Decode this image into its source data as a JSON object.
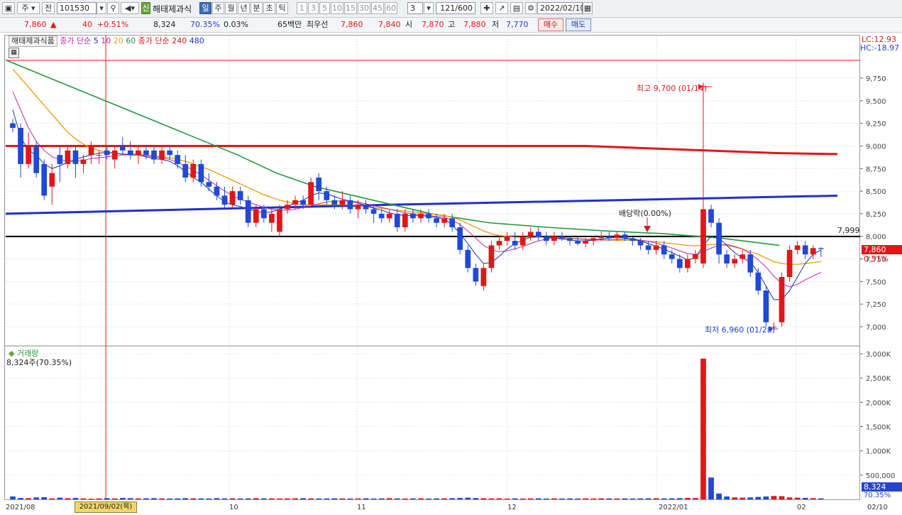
{
  "toolbar": {
    "period_type": "주",
    "market_label": "전",
    "stock_code": "101530",
    "stock_name": "해태제과식",
    "badge_label": "신",
    "period_tabs": [
      "일",
      "주",
      "월",
      "년",
      "분",
      "초",
      "틱"
    ],
    "interval_buttons": [
      "1",
      "3",
      "5",
      "10",
      "15",
      "30",
      "45",
      "60"
    ],
    "interval_value": "3",
    "count_display": "121",
    "count_total": "/600",
    "date_value": "2022/02/10"
  },
  "quote": {
    "price": "7,860",
    "arrow": "▲",
    "change": "40",
    "change_pct": "+0.51%",
    "volume": "8,324",
    "volume_ratio": "70.35%",
    "turnover": "0.03%",
    "amount": "65백만",
    "priority_label": "최우선",
    "ask": "7,860",
    "bid": "7,840",
    "open_label": "시",
    "open": "7,870",
    "high_label": "고",
    "high": "7,880",
    "low_label": "저",
    "low": "7,770",
    "buy_label": "매수",
    "sell_label": "매도"
  },
  "legend": {
    "name": "해태제과식품",
    "ma_label1": "종가 단순",
    "ma_short": [
      "5",
      "10",
      "20",
      "60"
    ],
    "ma_label2": "종가 단순",
    "ma_long": [
      "240",
      "480"
    ]
  },
  "annotations": {
    "high_note": "최고 9,700 (01/14)",
    "low_note": "최저 6,960 (01/28)",
    "dividend_note": "배당락(0.00%)",
    "hline_value": "7,999",
    "lc": "LC:12.93",
    "hc": "HC:-18.97",
    "price_tag": "7,860",
    "pct_tag": "0.51%",
    "vol_tag": "8,324",
    "vol_pct_tag": "70.35%"
  },
  "volume_panel": {
    "title": "거래량",
    "info": "8,324주(70.35%)"
  },
  "colors": {
    "up": "#e0161b",
    "down": "#1f49d6",
    "ma5": "#1c2fa8",
    "ma10": "#c026b3",
    "ma20": "#e6a117",
    "ma60": "#1f9a3a",
    "ma240": "#e0161b",
    "ma480": "#1f2fd0"
  },
  "chart_data": {
    "type": "candlestick",
    "y_ticks": [
      "9,750",
      "9,500",
      "9,250",
      "9,000",
      "8,750",
      "8,500",
      "8,250",
      "8,000",
      "7,750",
      "7,500",
      "7,250",
      "7,000"
    ],
    "ylim": [
      6800,
      10000
    ],
    "volume_ticks": [
      "3,000K",
      "2,500K",
      "2,000K",
      "1,500K",
      "1,000K",
      "500,000"
    ],
    "x_labels": [
      "2021/08",
      "9",
      "10",
      "11",
      "12",
      "2022/01",
      "02",
      "02/10"
    ],
    "selected_date": "2021/09/02(목)",
    "candles": [
      [
        9250,
        9300,
        9150,
        9200
      ],
      [
        9200,
        9250,
        8650,
        8800
      ],
      [
        8800,
        9150,
        8750,
        9000
      ],
      [
        9000,
        9050,
        8650,
        8700
      ],
      [
        8800,
        8850,
        8400,
        8450
      ],
      [
        8550,
        8800,
        8350,
        8700
      ],
      [
        8900,
        9000,
        8600,
        8800
      ],
      [
        8800,
        9000,
        8750,
        8950
      ],
      [
        8950,
        9000,
        8650,
        8800
      ],
      [
        8800,
        8900,
        8700,
        8850
      ],
      [
        8900,
        9050,
        8800,
        9000
      ],
      [
        8900,
        8950,
        8800,
        8900
      ],
      [
        8950,
        9000,
        8850,
        8900
      ],
      [
        8850,
        9000,
        8750,
        8950
      ],
      [
        9000,
        9100,
        8900,
        8950
      ],
      [
        8950,
        9050,
        8850,
        8900
      ],
      [
        8900,
        9000,
        8800,
        8950
      ],
      [
        8950,
        9000,
        8850,
        8900
      ],
      [
        8950,
        9000,
        8800,
        8850
      ],
      [
        8850,
        9000,
        8800,
        8950
      ],
      [
        8950,
        9000,
        8850,
        8900
      ],
      [
        8900,
        8950,
        8750,
        8800
      ],
      [
        8800,
        8900,
        8600,
        8650
      ],
      [
        8650,
        8850,
        8600,
        8800
      ],
      [
        8800,
        8850,
        8550,
        8600
      ],
      [
        8600,
        8700,
        8500,
        8550
      ],
      [
        8550,
        8600,
        8400,
        8450
      ],
      [
        8450,
        8550,
        8300,
        8350
      ],
      [
        8350,
        8550,
        8300,
        8500
      ],
      [
        8500,
        8550,
        8350,
        8400
      ],
      [
        8400,
        8450,
        8100,
        8150
      ],
      [
        8150,
        8350,
        8100,
        8300
      ],
      [
        8300,
        8350,
        8150,
        8200
      ],
      [
        8150,
        8300,
        8050,
        8250
      ],
      [
        8050,
        8350,
        8000,
        8300
      ],
      [
        8300,
        8400,
        8250,
        8350
      ],
      [
        8350,
        8450,
        8300,
        8400
      ],
      [
        8400,
        8450,
        8300,
        8350
      ],
      [
        8350,
        8650,
        8350,
        8600
      ],
      [
        8650,
        8700,
        8400,
        8500
      ],
      [
        8500,
        8550,
        8350,
        8400
      ],
      [
        8400,
        8450,
        8300,
        8350
      ],
      [
        8350,
        8500,
        8300,
        8400
      ],
      [
        8400,
        8450,
        8250,
        8300
      ],
      [
        8300,
        8400,
        8200,
        8350
      ],
      [
        8350,
        8400,
        8250,
        8300
      ],
      [
        8300,
        8350,
        8150,
        8250
      ],
      [
        8250,
        8300,
        8150,
        8200
      ],
      [
        8200,
        8300,
        8150,
        8250
      ],
      [
        8250,
        8300,
        8050,
        8100
      ],
      [
        8100,
        8300,
        8050,
        8250
      ],
      [
        8250,
        8300,
        8150,
        8200
      ],
      [
        8200,
        8300,
        8150,
        8250
      ],
      [
        8250,
        8300,
        8150,
        8200
      ],
      [
        8200,
        8250,
        8100,
        8150
      ],
      [
        8150,
        8250,
        8100,
        8200
      ],
      [
        8200,
        8250,
        8050,
        8100
      ],
      [
        8100,
        8150,
        7800,
        7850
      ],
      [
        7850,
        7900,
        7600,
        7650
      ],
      [
        7650,
        7700,
        7450,
        7500
      ],
      [
        7450,
        7700,
        7400,
        7650
      ],
      [
        7650,
        7950,
        7600,
        7900
      ],
      [
        7900,
        8000,
        7850,
        7950
      ],
      [
        7950,
        8050,
        7900,
        8000
      ],
      [
        7950,
        8050,
        7850,
        7900
      ],
      [
        7900,
        8050,
        7850,
        8000
      ],
      [
        8000,
        8100,
        7950,
        8050
      ],
      [
        8050,
        8100,
        7950,
        8000
      ],
      [
        8000,
        8050,
        7900,
        7950
      ],
      [
        7950,
        8050,
        7900,
        8000
      ],
      [
        8000,
        8050,
        7950,
        7980
      ],
      [
        7980,
        8000,
        7900,
        7950
      ],
      [
        7950,
        8000,
        7900,
        7920
      ],
      [
        7920,
        7980,
        7880,
        7950
      ],
      [
        7950,
        8000,
        7900,
        7980
      ],
      [
        7980,
        8050,
        7950,
        8000
      ],
      [
        8000,
        8050,
        7950,
        7980
      ],
      [
        7980,
        8050,
        7950,
        8020
      ],
      [
        8020,
        8050,
        7950,
        7980
      ],
      [
        7980,
        8000,
        7900,
        7950
      ],
      [
        7950,
        7980,
        7850,
        7900
      ],
      [
        7900,
        7950,
        7800,
        7850
      ],
      [
        7850,
        7950,
        7800,
        7900
      ],
      [
        7900,
        7950,
        7750,
        7800
      ],
      [
        7800,
        7850,
        7700,
        7750
      ],
      [
        7750,
        7800,
        7600,
        7650
      ],
      [
        7650,
        7800,
        7600,
        7750
      ],
      [
        7750,
        7850,
        7700,
        7800
      ],
      [
        7700,
        9700,
        7650,
        8300
      ],
      [
        8300,
        8350,
        8100,
        8150
      ],
      [
        8150,
        8200,
        7700,
        7800
      ],
      [
        7800,
        7850,
        7650,
        7700
      ],
      [
        7700,
        7800,
        7650,
        7750
      ],
      [
        7750,
        7850,
        7700,
        7800
      ],
      [
        7800,
        7850,
        7550,
        7600
      ],
      [
        7600,
        7650,
        7350,
        7400
      ],
      [
        7400,
        7450,
        7000,
        7050
      ],
      [
        7000,
        7050,
        6960,
        7000
      ],
      [
        7050,
        7600,
        7000,
        7550
      ],
      [
        7550,
        7900,
        7500,
        7850
      ],
      [
        7850,
        7950,
        7800,
        7900
      ],
      [
        7900,
        7950,
        7750,
        7800
      ],
      [
        7800,
        7900,
        7750,
        7870
      ],
      [
        7870,
        7880,
        7770,
        7860
      ]
    ],
    "ma": {
      "ma5": [
        9400,
        9100,
        8950,
        8900,
        8800,
        8750,
        8780,
        8820,
        8850,
        8880,
        8900,
        8920,
        8930,
        8920,
        8910,
        8900,
        8900,
        8880,
        8860,
        8850,
        8830,
        8780,
        8720,
        8650,
        8600,
        8520,
        8450,
        8380,
        8350,
        8330,
        8300,
        8280,
        8260,
        8270,
        8300,
        8330,
        8370,
        8400,
        8450,
        8480,
        8470,
        8440,
        8410,
        8390,
        8370,
        8340,
        8310,
        8290,
        8260,
        8240,
        8230,
        8230,
        8230,
        8220,
        8210,
        8190,
        8130,
        8030,
        7920,
        7800,
        7700,
        7710,
        7780,
        7860,
        7920,
        7960,
        7990,
        8000,
        7990,
        7980,
        7970,
        7960,
        7950,
        7950,
        7960,
        7970,
        7980,
        7990,
        7980,
        7970,
        7950,
        7920,
        7890,
        7860,
        7820,
        7780,
        7740,
        7760,
        7900,
        8000,
        7980,
        7900,
        7820,
        7760,
        7720,
        7600,
        7450,
        7300,
        7300,
        7400,
        7550,
        7700,
        7800,
        7850
      ],
      "ma10": [
        9600,
        9400,
        9200,
        9050,
        8950,
        8880,
        8850,
        8830,
        8830,
        8840,
        8860,
        8870,
        8880,
        8890,
        8900,
        8900,
        8900,
        8890,
        8880,
        8870,
        8850,
        8820,
        8780,
        8730,
        8680,
        8620,
        8560,
        8500,
        8450,
        8410,
        8380,
        8350,
        8320,
        8300,
        8290,
        8290,
        8300,
        8320,
        8340,
        8360,
        8380,
        8390,
        8390,
        8390,
        8380,
        8360,
        8340,
        8320,
        8300,
        8280,
        8260,
        8250,
        8240,
        8230,
        8220,
        8210,
        8180,
        8130,
        8060,
        7980,
        7900,
        7850,
        7830,
        7840,
        7860,
        7890,
        7920,
        7950,
        7970,
        7980,
        7980,
        7975,
        7970,
        7965,
        7960,
        7960,
        7962,
        7965,
        7968,
        7970,
        7960,
        7945,
        7925,
        7900,
        7870,
        7840,
        7810,
        7800,
        7830,
        7870,
        7900,
        7910,
        7890,
        7860,
        7810,
        7740,
        7660,
        7560,
        7480,
        7440,
        7470,
        7520,
        7560,
        7600
      ],
      "ma20": [
        9850,
        9750,
        9650,
        9550,
        9450,
        9350,
        9250,
        9150,
        9080,
        9020,
        8980,
        8950,
        8930,
        8920,
        8910,
        8910,
        8910,
        8900,
        8890,
        8880,
        8870,
        8850,
        8830,
        8800,
        8770,
        8740,
        8700,
        8660,
        8620,
        8580,
        8540,
        8500,
        8460,
        8430,
        8400,
        8380,
        8360,
        8350,
        8350,
        8350,
        8350,
        8350,
        8350,
        8350,
        8340,
        8330,
        8320,
        8310,
        8300,
        8290,
        8280,
        8270,
        8260,
        8250,
        8240,
        8230,
        8210,
        8180,
        8140,
        8100,
        8060,
        8030,
        8010,
        8000,
        7990,
        7990,
        7990,
        7990,
        7990,
        7990,
        7985,
        7980,
        7975,
        7970,
        7965,
        7960,
        7958,
        7957,
        7956,
        7955,
        7950,
        7945,
        7940,
        7930,
        7920,
        7910,
        7900,
        7895,
        7900,
        7910,
        7910,
        7900,
        7880,
        7860,
        7830,
        7800,
        7760,
        7720,
        7700,
        7690,
        7690,
        7700,
        7710,
        7720
      ]
    },
    "ma60_line": [
      [
        0,
        9950
      ],
      [
        20,
        9600
      ],
      [
        40,
        9250
      ],
      [
        60,
        8900
      ],
      [
        70,
        8700
      ],
      [
        80,
        8550
      ],
      [
        90,
        8450
      ],
      [
        100,
        8350
      ],
      [
        110,
        8250
      ],
      [
        125,
        8150
      ],
      [
        140,
        8100
      ],
      [
        155,
        8060
      ],
      [
        170,
        8030
      ],
      [
        185,
        7980
      ],
      [
        200,
        7900
      ]
    ],
    "ma240_line": [
      [
        0,
        9000
      ],
      [
        150,
        9000
      ],
      [
        200,
        8920
      ],
      [
        215,
        8910
      ]
    ],
    "ma480_line": [
      [
        0,
        8250
      ],
      [
        100,
        8350
      ],
      [
        215,
        8450
      ]
    ],
    "hline": 7999,
    "volume_k": [
      60,
      30,
      25,
      40,
      45,
      20,
      35,
      25,
      30,
      20,
      15,
      20,
      25,
      20,
      30,
      25,
      20,
      22,
      25,
      20,
      18,
      20,
      25,
      22,
      20,
      18,
      25,
      20,
      22,
      18,
      20,
      25,
      22,
      20,
      18,
      20,
      22,
      25,
      20,
      18,
      20,
      22,
      20,
      18,
      20,
      22,
      18,
      20,
      25,
      20,
      18,
      20,
      22,
      18,
      20,
      22,
      25,
      30,
      35,
      28,
      25,
      20,
      22,
      18,
      20,
      18,
      20,
      22,
      18,
      20,
      18,
      20,
      18,
      20,
      18,
      22,
      20,
      18,
      20,
      18,
      20,
      22,
      25,
      20,
      22,
      25,
      30,
      28,
      2900,
      450,
      120,
      60,
      40,
      35,
      40,
      50,
      60,
      70,
      65,
      40,
      35,
      30,
      25,
      20
    ]
  }
}
